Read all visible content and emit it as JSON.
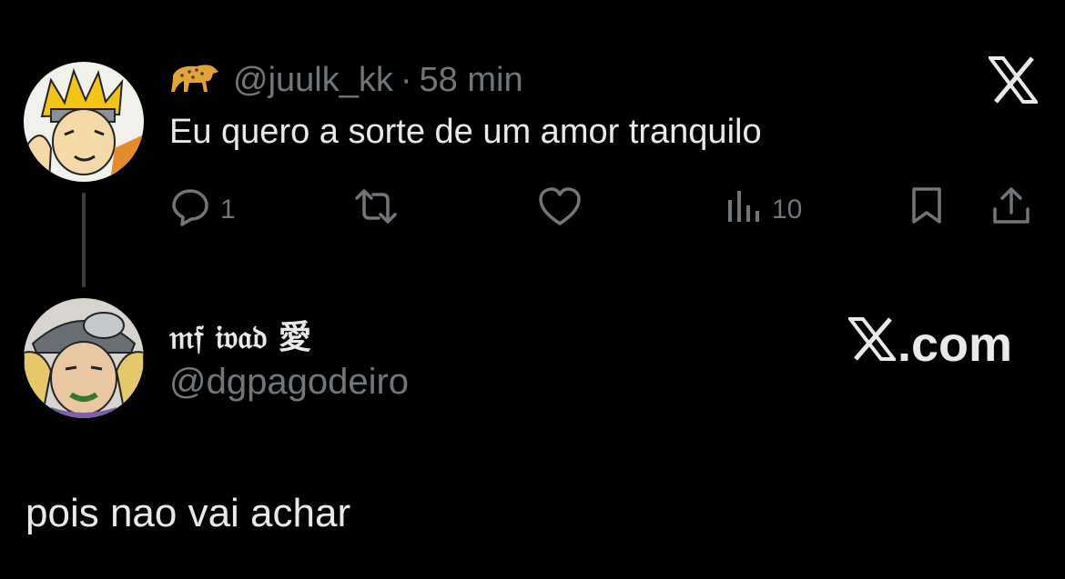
{
  "tweet": {
    "handle": "@juulk_kk",
    "separator": "·",
    "time": "58 min",
    "text": "Eu quero a sorte de um amor tranquilo",
    "badge_icon": "leopard-icon",
    "actions": {
      "replies": "1",
      "views": "10"
    }
  },
  "reply_author": {
    "display_name": "𝔪𝔣 𝔦𝔳𝔞𝔡 愛",
    "handle": "@dgpagodeiro"
  },
  "brand": {
    "label": ".com"
  },
  "reply": {
    "text": "pois nao vai achar"
  },
  "colors": {
    "background": "#000000",
    "text": "#e7e9ea",
    "muted": "#71767b"
  }
}
